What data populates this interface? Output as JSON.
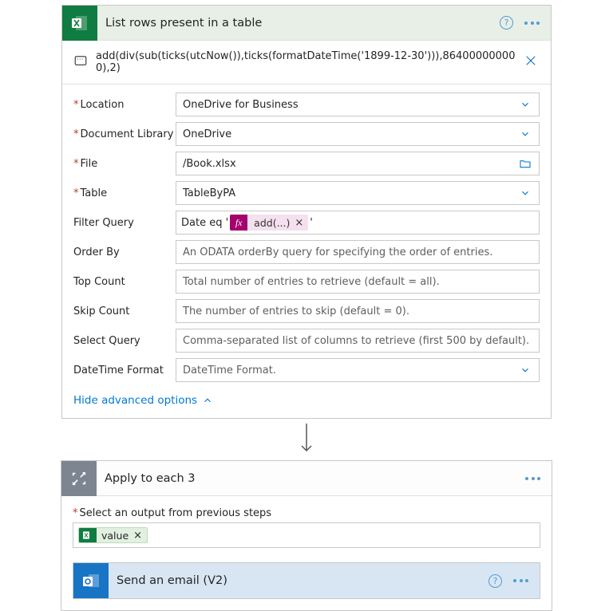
{
  "excel_card": {
    "title": "List rows present in a table",
    "expression": "add(div(sub(ticks(utcNow()),ticks(formatDateTime('1899-12-30'))),864000000000),2)",
    "fields": {
      "location": {
        "label": "Location",
        "value": "OneDrive for Business"
      },
      "documentLibrary": {
        "label": "Document Library",
        "value": "OneDrive"
      },
      "file": {
        "label": "File",
        "value": "/Book.xlsx"
      },
      "table": {
        "label": "Table",
        "value": "TableByPA"
      },
      "filterQuery": {
        "label": "Filter Query",
        "prefix": "Date eq '",
        "pill": "add(...)",
        "suffix": "'"
      },
      "orderBy": {
        "label": "Order By",
        "placeholder": "An ODATA orderBy query for specifying the order of entries."
      },
      "topCount": {
        "label": "Top Count",
        "placeholder": "Total number of entries to retrieve (default = all)."
      },
      "skipCount": {
        "label": "Skip Count",
        "placeholder": "The number of entries to skip (default = 0)."
      },
      "selectQuery": {
        "label": "Select Query",
        "placeholder": "Comma-separated list of columns to retrieve (first 500 by default)."
      },
      "dateTimeFormat": {
        "label": "DateTime Format",
        "placeholder": "DateTime Format."
      }
    },
    "advanced_link": "Hide advanced options"
  },
  "apply_each": {
    "title": "Apply to each 3",
    "select_label": "Select an output from previous steps",
    "value_pill": "value"
  },
  "email_card": {
    "title": "Send an email (V2)"
  },
  "fx_badge": "fx"
}
